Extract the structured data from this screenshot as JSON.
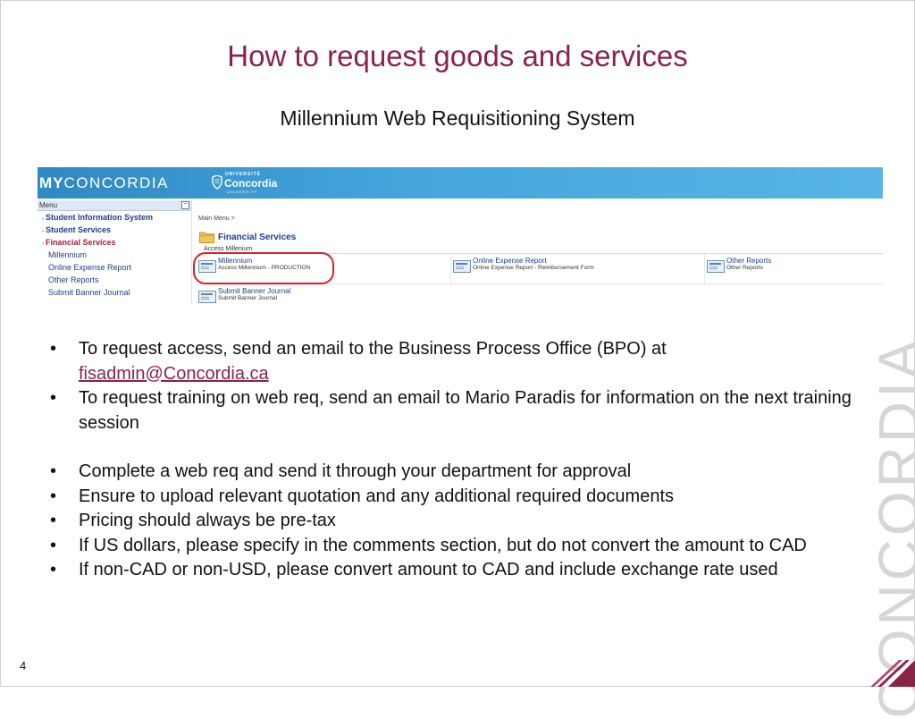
{
  "slide": {
    "title": "How to request goods and services",
    "subtitle": "Millennium Web Requisitioning System",
    "page_number": "4",
    "watermark": "CONCORDIA",
    "accent_color": "#8b2346"
  },
  "portal": {
    "brand_bold": "MY",
    "brand_rest": "CONCORDIA",
    "logo_small": "UNIVERSITÉ",
    "logo_main": "Concordia",
    "logo_sub": "UNIVERSITY",
    "menu_label": "Menu",
    "menu_collapse": "−",
    "menu_items": [
      {
        "label": "Student Information System"
      },
      {
        "label": "Student Services"
      },
      {
        "label": "Financial Services"
      },
      {
        "label": "Millennium"
      },
      {
        "label": "Online Expense Report"
      },
      {
        "label": "Other Reports"
      },
      {
        "label": "Submit Banner Journal"
      }
    ],
    "breadcrumb": "Main Menu >",
    "section_title": "Financial Services",
    "access_label": "Access Millenium",
    "tiles": [
      {
        "title": "Millennium",
        "desc": "Access Millennium - PRODUCTION",
        "icon": "report-icon"
      },
      {
        "title": "Online Expense Report",
        "desc": "Online Expense Report - Reimbursement Form",
        "icon": "report-icon"
      },
      {
        "title": "Other Reports",
        "desc": "Other Reports",
        "icon": "report-icon"
      },
      {
        "title": "Submit Banner Journal",
        "desc": "Submit Banner Journal",
        "icon": "report-icon"
      }
    ],
    "header_color": "#3a96d0"
  },
  "bullets": {
    "b1_text": "To request access, send an email to the Business Process Office (BPO) at",
    "b1_link": "fisadmin@Concordia.ca",
    "b2": "To request training on web req, send an email to Mario Paradis for information on the next training session",
    "b3": "Complete a web req and send it through your department for approval",
    "b4": "Ensure to upload relevant quotation and any additional required documents",
    "b5": "Pricing should always be pre-tax",
    "b6": "If US dollars, please specify in the comments section, but do not convert the amount to CAD",
    "b7": "If non-CAD or non-USD, please convert amount to CAD and include exchange rate used"
  }
}
